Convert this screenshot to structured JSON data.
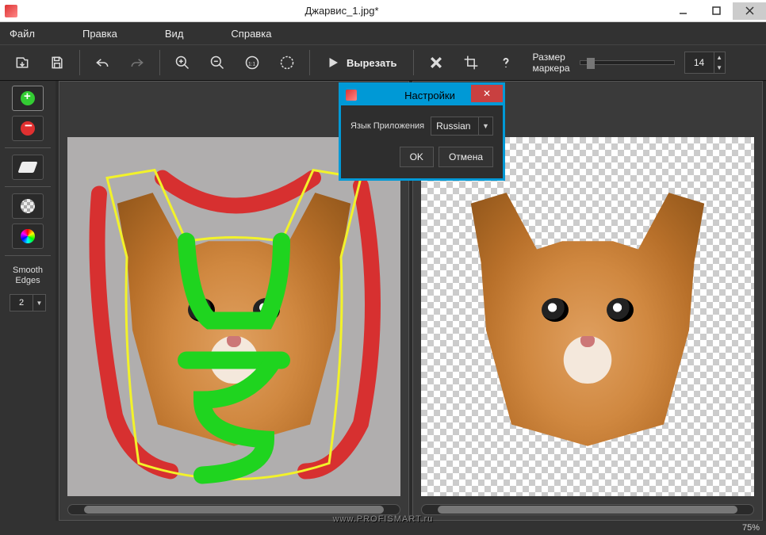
{
  "window": {
    "title": "Джарвис_1.jpg*"
  },
  "menu": {
    "file": "Файл",
    "edit": "Правка",
    "view": "Вид",
    "help": "Справка"
  },
  "toolbar": {
    "cut_label": "Вырезать",
    "marker_size_label_l1": "Размер",
    "marker_size_label_l2": "маркера",
    "marker_size_value": "14"
  },
  "side": {
    "smooth_label_l1": "Smooth",
    "smooth_label_l2": "Edges",
    "smooth_value": "2"
  },
  "dialog": {
    "title": "Настройки",
    "lang_label": "Язык Приложения",
    "lang_value": "Russian",
    "ok": "OK",
    "cancel": "Отмена"
  },
  "status": {
    "zoom": "75%"
  },
  "watermark": "www.PROFISMART.ru"
}
